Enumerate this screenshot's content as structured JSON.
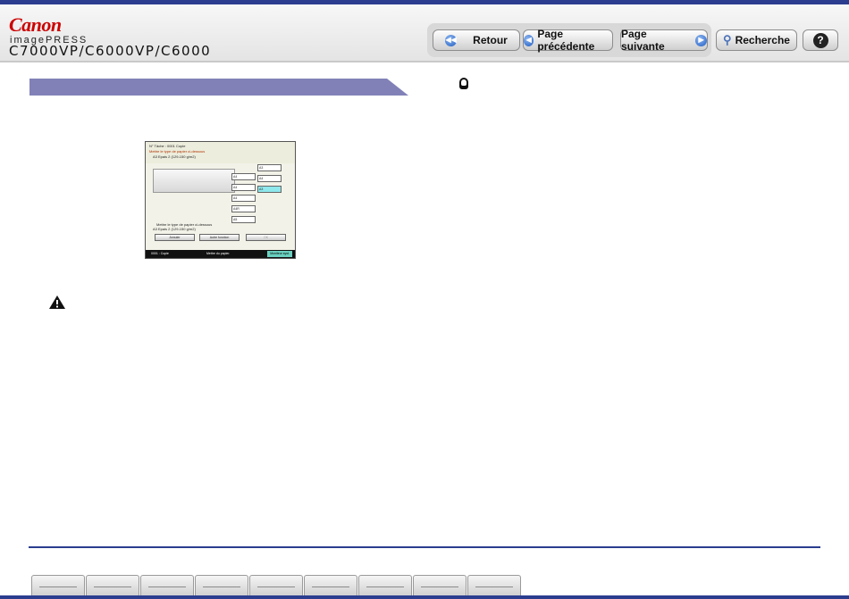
{
  "header": {
    "brand": "Canon",
    "product": "imagePRESS",
    "model": "C7000VP/C6000VP/C6000"
  },
  "nav": {
    "back_label": "Retour",
    "prev_label": "Page précédente",
    "next_label": "Page suivante",
    "search_label": "Recherche",
    "help_label": "?"
  },
  "screenshot": {
    "line1": "N° Tâche : 0001    Copie",
    "line2": "Mettre le type de papier ci-dessous",
    "line3": "A3            Epais 2 (129-150 g/m2)",
    "slots": [
      "A4",
      "A4",
      "A4",
      "A4R",
      "A5",
      "A3",
      "A4",
      "A3"
    ],
    "footer_note": "Mettre le type de papier ci-dessous",
    "bottom_line": "A3            Epais 2 (129-150 g/m2)",
    "cancel_label": "Annuler",
    "other_label": "Autre fonction",
    "ok_label": "OK",
    "status_left": "0001 : Copie",
    "status_mid": "Mettre du papier.",
    "status_right": "Moniteur syst."
  },
  "tabs": [
    "",
    "",
    "",
    "",
    "",
    "",
    "",
    "",
    "",
    ""
  ]
}
